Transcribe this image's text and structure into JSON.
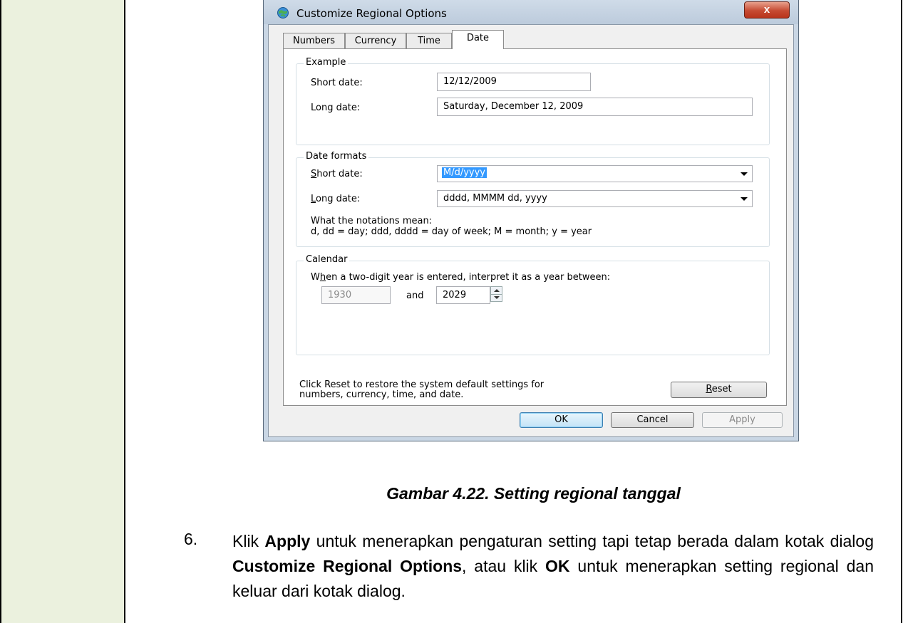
{
  "dialog": {
    "title": "Customize Regional Options",
    "close_label": "x",
    "tabs": [
      {
        "label": "Numbers"
      },
      {
        "label": "Currency"
      },
      {
        "label": "Time"
      },
      {
        "label": "Date"
      }
    ],
    "active_tab": "Date",
    "example": {
      "group_label": "Example",
      "short_date_label": "Short date:",
      "short_date_value": "12/12/2009",
      "long_date_label": "Long date:",
      "long_date_value": "Saturday, December 12, 2009"
    },
    "formats": {
      "group_label": "Date formats",
      "short_date_label_rest": "hort date:",
      "short_date_label_acc": "S",
      "short_date_value": "M/d/yyyy",
      "long_date_label_acc": "L",
      "long_date_label_rest": "ong date:",
      "long_date_value": "dddd, MMMM dd, yyyy",
      "notation_title": "What the notations mean:",
      "notation_text": "d, dd = day;  ddd, dddd = day of week;  M = month;  y = year"
    },
    "calendar": {
      "group_label": "Calendar",
      "desc_pre": "W",
      "desc_acc": "h",
      "desc_post": "en a two-digit year is entered, interpret it as a year between:",
      "year_from": "1930",
      "and_label": "and",
      "year_to": "2029"
    },
    "reset_note_line1": "Click Reset to restore the system default settings for",
    "reset_note_line2": "numbers, currency, time, and date.",
    "reset_acc": "R",
    "reset_rest": "eset",
    "ok_label": "OK",
    "cancel_label": "Cancel",
    "apply_label": "Apply"
  },
  "caption": "Gambar 4.22. Setting regional tanggal",
  "step": {
    "number": "6.",
    "t1": "Klik ",
    "b1": "Apply",
    "t2": " untuk menerapkan pengaturan setting tapi tetap berada dalam kotak dialog ",
    "b2": "Customize Regional Options",
    "t3": ", atau klik ",
    "b3": "OK",
    "t4": " untuk menerapkan setting regional dan keluar dari kotak dialog."
  },
  "colors": {
    "left_column": "#ebf1de",
    "selection": "#3399ff",
    "close_button": "#c64a32"
  }
}
